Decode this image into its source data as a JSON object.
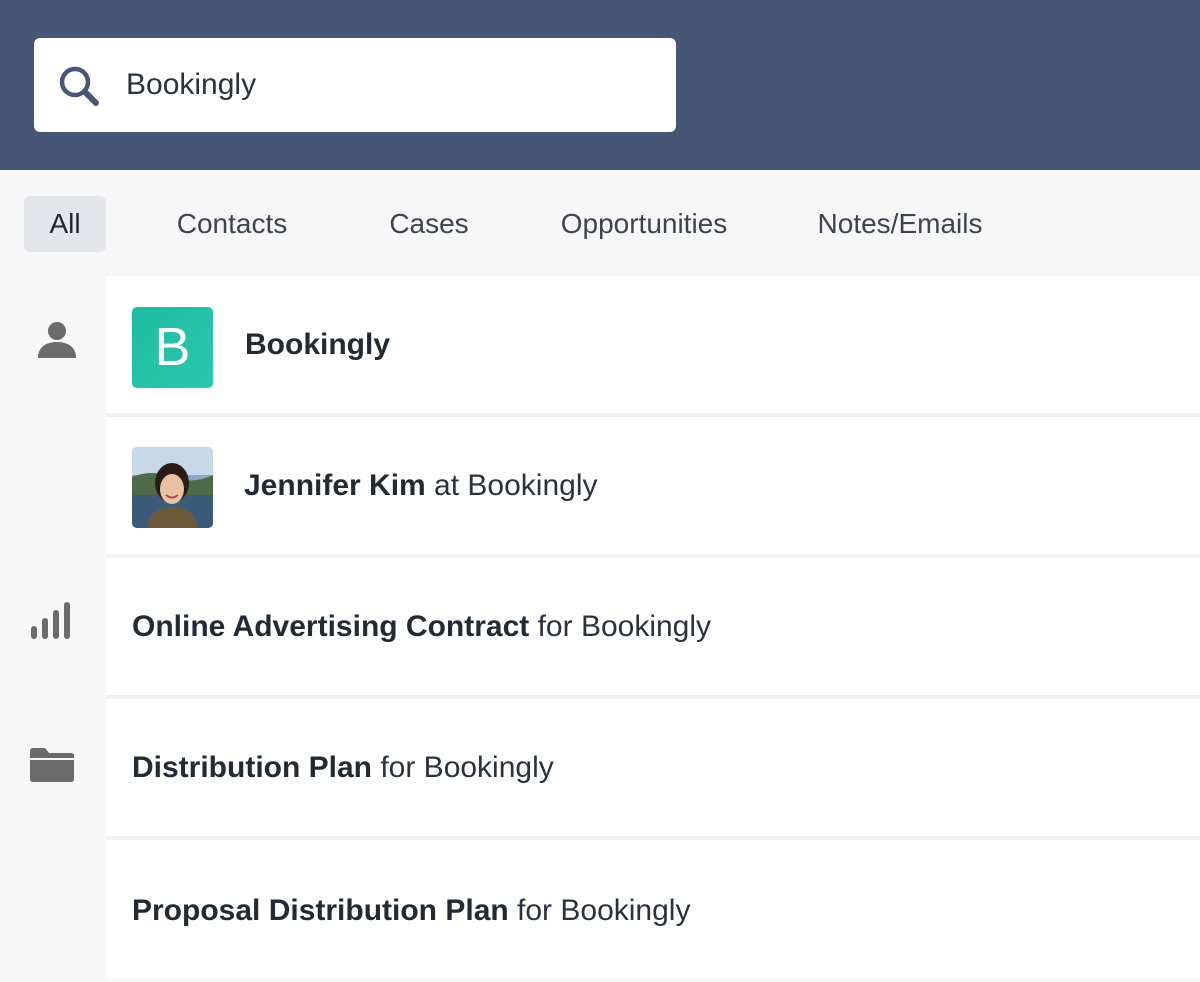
{
  "search": {
    "value": "Bookingly",
    "icon": "search-icon"
  },
  "tabs": [
    {
      "label": "All",
      "active": true
    },
    {
      "label": "Contacts"
    },
    {
      "label": "Cases"
    },
    {
      "label": "Opportunities"
    },
    {
      "label": "Notes/Emails"
    }
  ],
  "rail_icons": [
    "person-icon",
    "signal-bars-icon",
    "folder-icon"
  ],
  "results": [
    {
      "type": "company",
      "avatar_letter": "B",
      "title": "Bookingly",
      "suffix": ""
    },
    {
      "type": "contact",
      "avatar": "contact-photo",
      "title": "Jennifer Kim",
      "suffix": " at Bookingly"
    },
    {
      "type": "opportunity",
      "title": "Online Advertising Contract",
      "suffix": " for Bookingly"
    },
    {
      "type": "case",
      "title": "Distribution Plan",
      "suffix": " for Bookingly"
    },
    {
      "type": "case",
      "title": "Proposal Distribution Plan",
      "suffix": " for Bookingly"
    }
  ],
  "colors": {
    "header_bg": "#485676",
    "company_avatar": "#1ebd9e",
    "active_tab_bg": "#e3e6ea"
  }
}
